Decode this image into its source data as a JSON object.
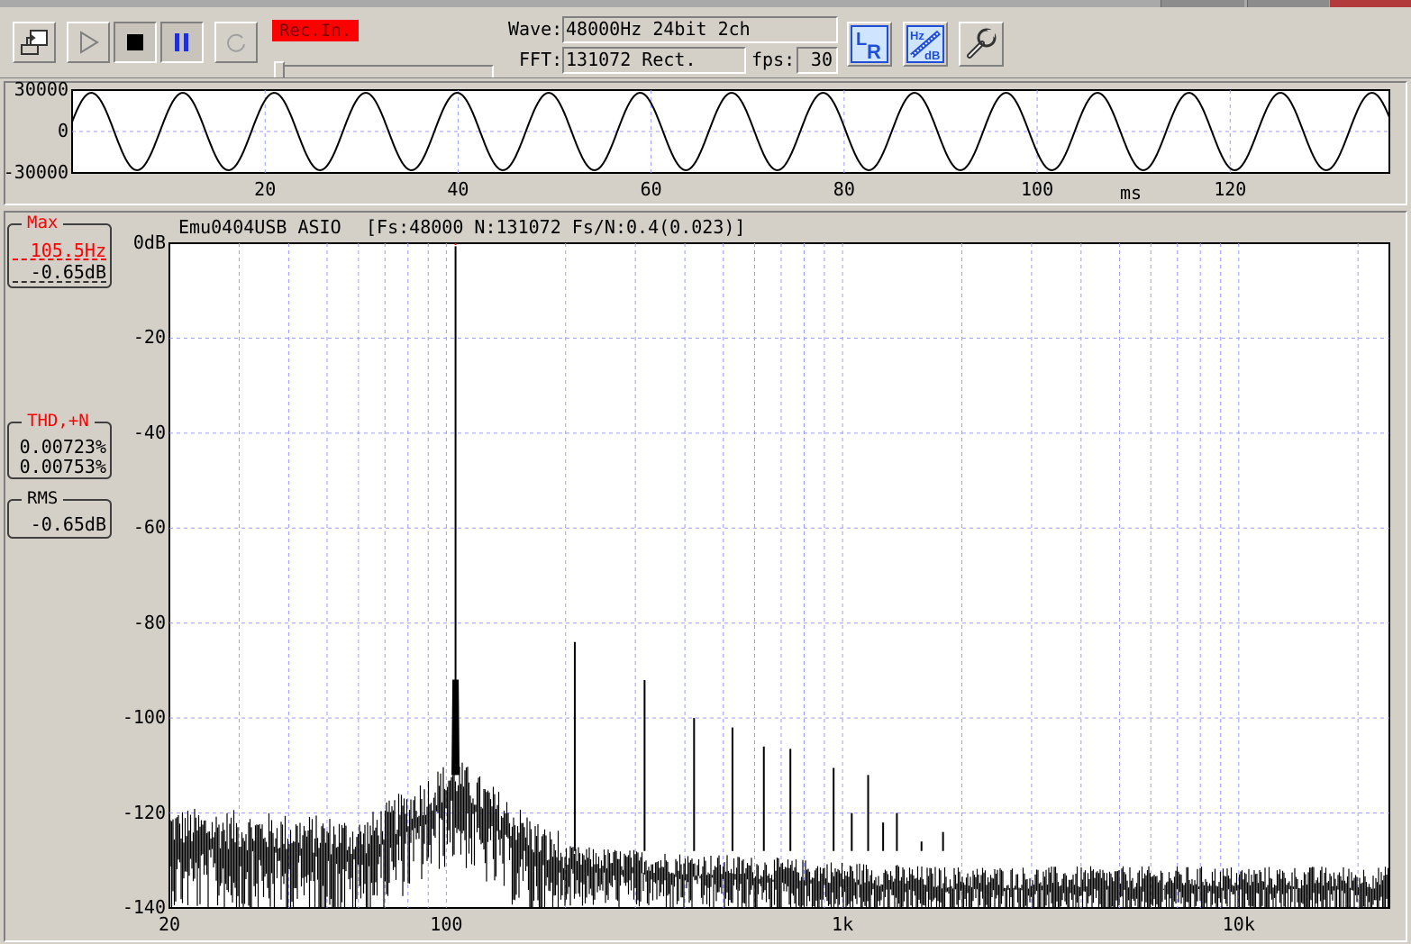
{
  "toolbar": {
    "rec_badge": "Rec.In.",
    "wave_label": "Wave:",
    "wave_value": "48000Hz 24bit 2ch",
    "fft_label": "FFT:",
    "fft_value": "131072 Rect.",
    "fps_label": "fps:",
    "fps_value": "30",
    "icons": [
      "export-icon",
      "play-icon",
      "stop-icon",
      "pause-icon",
      "repeat-icon",
      "lr-channel-icon",
      "hz-db-scale-icon",
      "wrench-settings-icon"
    ]
  },
  "waveform": {
    "y_ticks": [
      "30000",
      "0",
      "-30000"
    ],
    "x_ticks": [
      "20",
      "40",
      "60",
      "80",
      "100",
      "120"
    ],
    "x_unit": "ms",
    "chart_data": {
      "type": "line",
      "ylim": [
        -30000,
        30000
      ],
      "xlim": [
        0,
        136.5
      ],
      "frequency_hz": 105.5,
      "amplitude": 28000,
      "grid": true
    }
  },
  "spectrum": {
    "header": "Emu0404USB ASIO",
    "header_params": "[Fs:48000 N:131072 Fs/N:0.4(0.023)]",
    "y_ticks": [
      "0dB",
      "-20",
      "-40",
      "-60",
      "-80",
      "-100",
      "-120",
      "-140"
    ],
    "x_ticks": [
      "20",
      "100",
      "1k",
      "10k"
    ],
    "chart_data": {
      "type": "line",
      "x_scale": "log",
      "xlim": [
        20,
        24000
      ],
      "ylim": [
        -140,
        0
      ],
      "grid": true,
      "fundamental": {
        "freq_hz": 105.5,
        "level_db": -0.65
      },
      "harmonics": [
        {
          "freq_hz": 211,
          "level_db": -84
        },
        {
          "freq_hz": 316.5,
          "level_db": -92
        },
        {
          "freq_hz": 422,
          "level_db": -100
        },
        {
          "freq_hz": 527.5,
          "level_db": -102
        },
        {
          "freq_hz": 633,
          "level_db": -106
        },
        {
          "freq_hz": 738.5,
          "level_db": -106.5
        },
        {
          "freq_hz": 949.5,
          "level_db": -110.5
        },
        {
          "freq_hz": 1055,
          "level_db": -120
        },
        {
          "freq_hz": 1160.5,
          "level_db": -112
        },
        {
          "freq_hz": 1266,
          "level_db": -122
        },
        {
          "freq_hz": 1371.5,
          "level_db": -120
        },
        {
          "freq_hz": 1582.5,
          "level_db": -126
        },
        {
          "freq_hz": 1793.5,
          "level_db": -124
        }
      ],
      "noise_floor_db": {
        "low_freq": -127,
        "high_freq": -136
      }
    }
  },
  "readouts": {
    "max": {
      "caption": "Max",
      "freq": "105.5Hz",
      "level": "-0.65dB"
    },
    "thd": {
      "caption": "THD,+N",
      "value1": "0.00723%",
      "value2": "0.00753%"
    },
    "rms": {
      "caption": "RMS",
      "value": "-0.65dB"
    }
  },
  "colors": {
    "background": "#d4d0c8",
    "plot_bg": "#ffffff",
    "grid": "#9a9aff",
    "trace": "#000000",
    "accent_red": "#ff0000",
    "icon_blue": "#1f4fd8"
  }
}
